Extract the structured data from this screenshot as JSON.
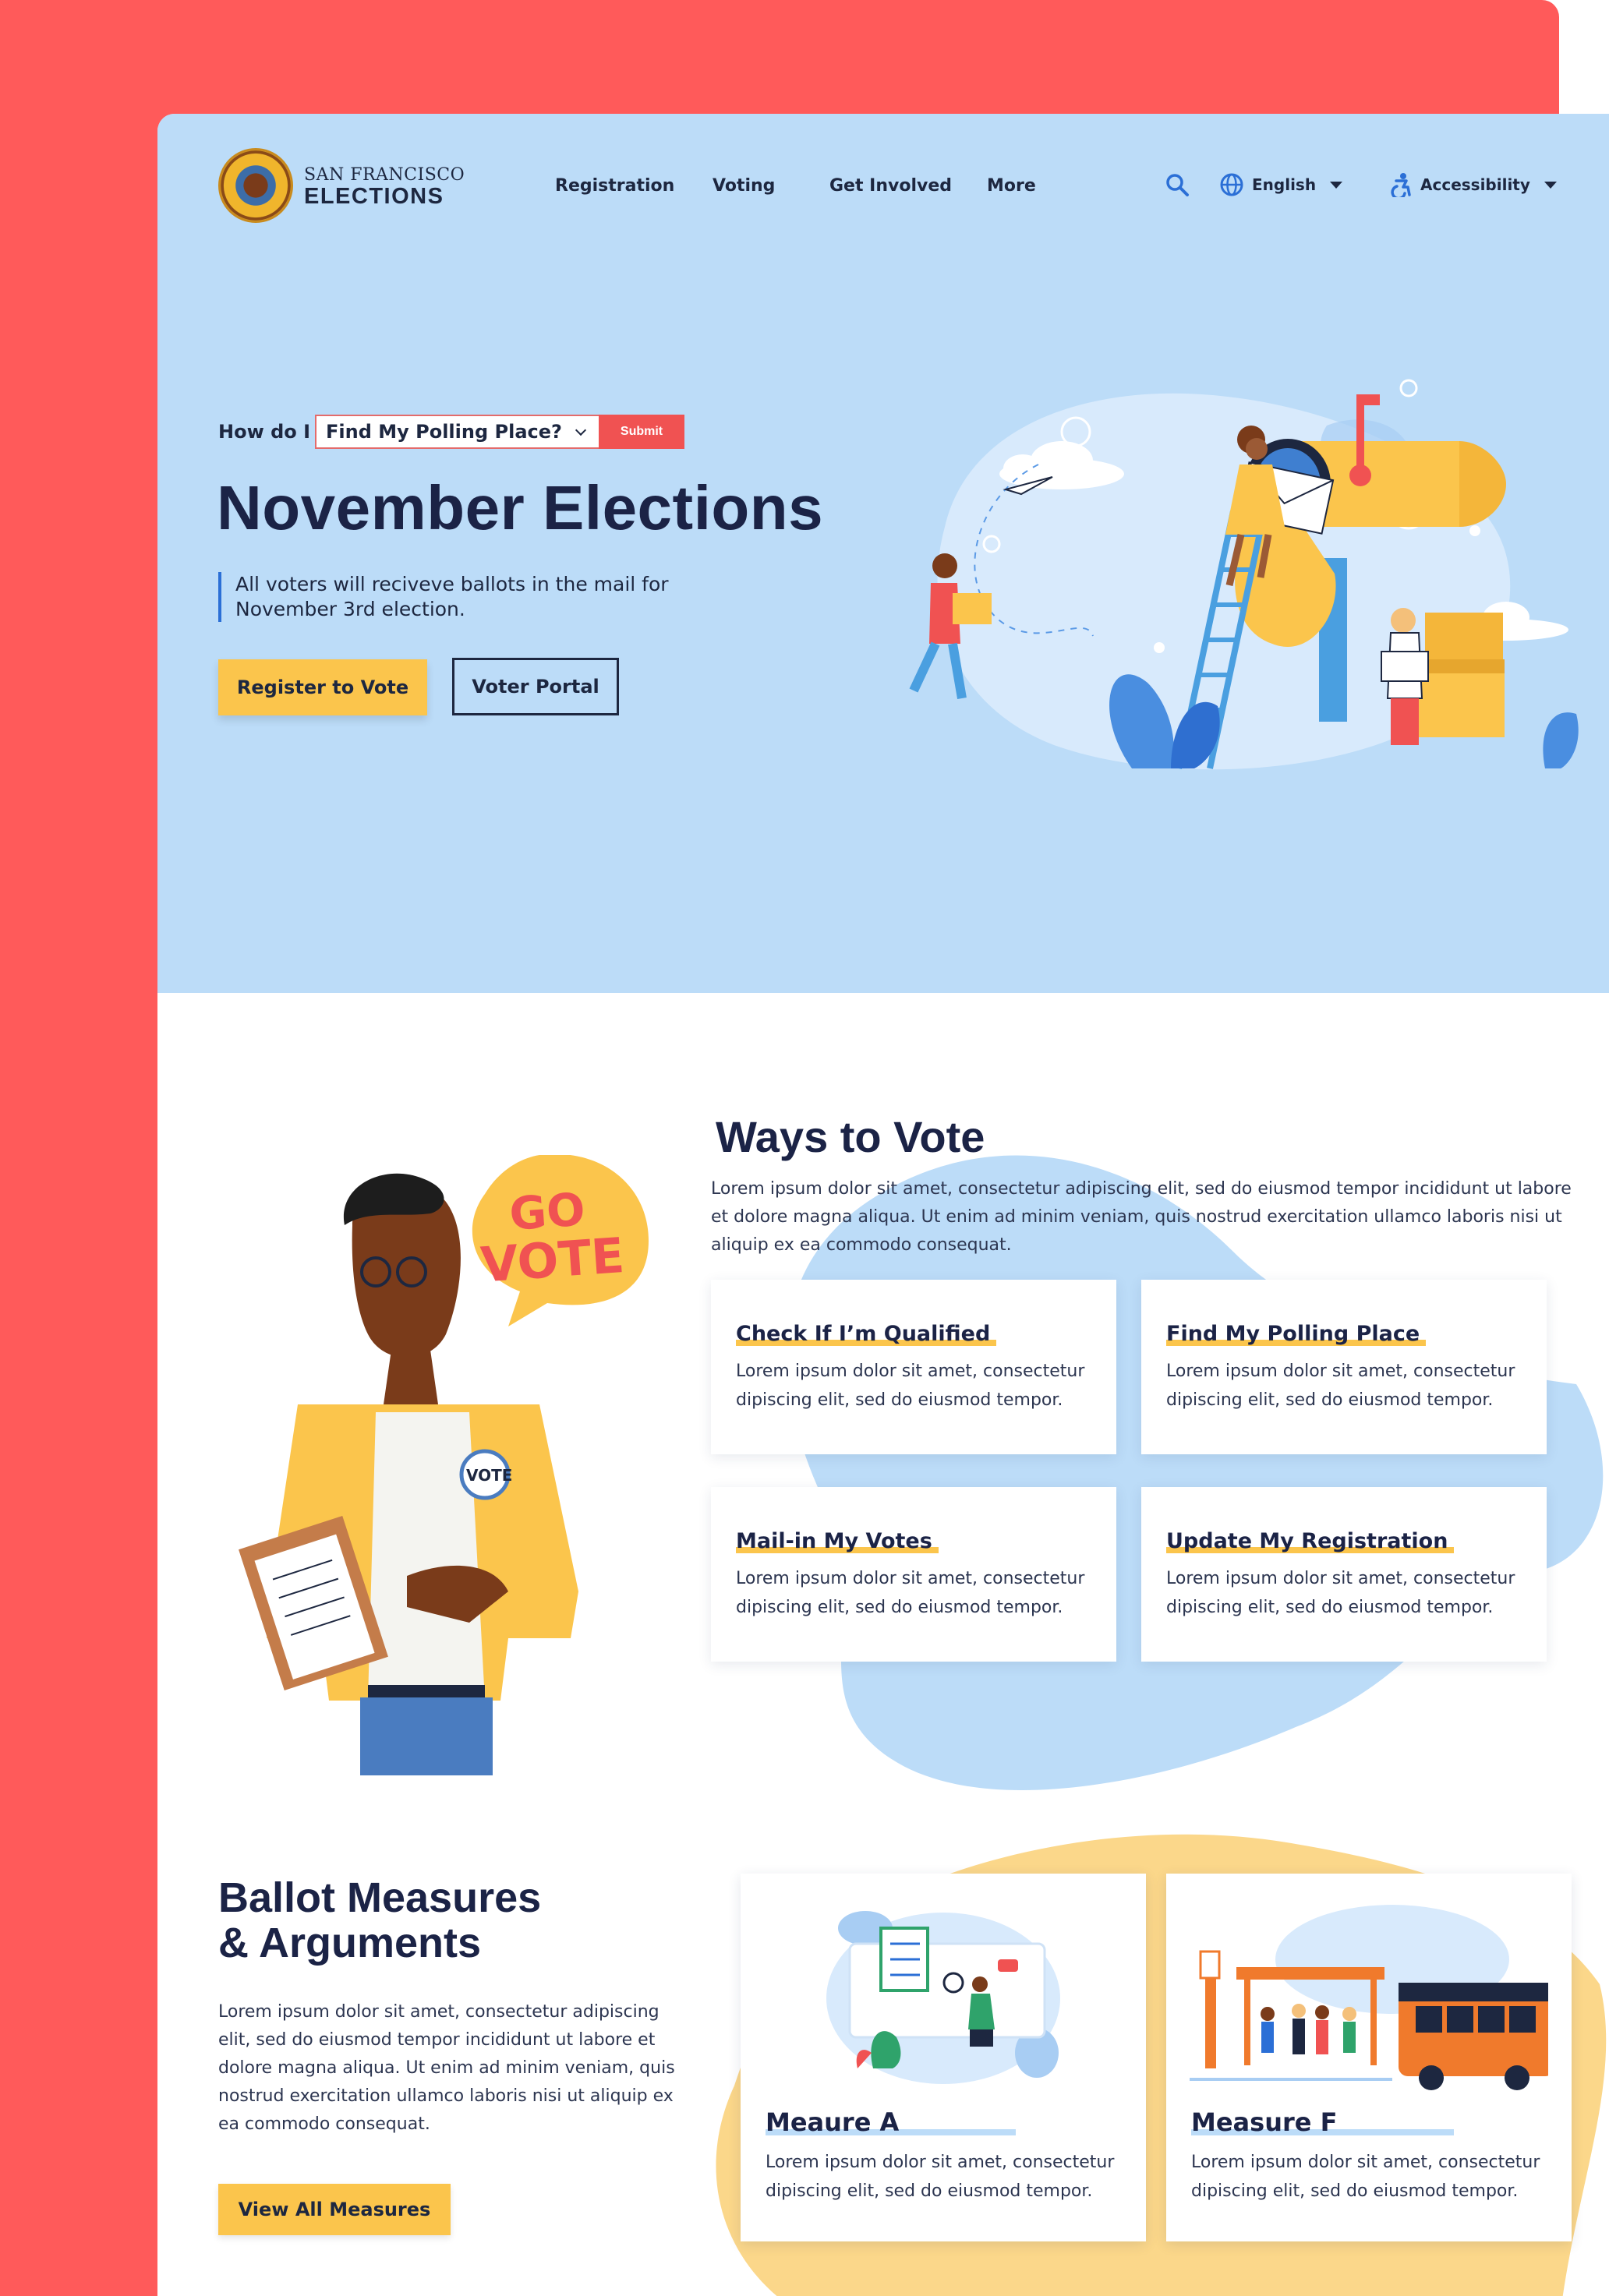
{
  "brand": {
    "line1": "SAN FRANCISCO",
    "line2": "ELECTIONS"
  },
  "nav": {
    "items": [
      {
        "label": "Registration"
      },
      {
        "label": "Voting"
      },
      {
        "label": "Get Involved"
      },
      {
        "label": "More"
      }
    ],
    "language": "English",
    "accessibility": "Accessibility"
  },
  "hero": {
    "how_do_i_label": "How do I",
    "how_do_i_selected": "Find My Polling Place?",
    "submit_label": "Submit",
    "title": "November Elections",
    "subtitle": "All voters will reciveve ballots in the mail for November 3rd election.",
    "primary_button": "Register to Vote",
    "secondary_button": "Voter Portal"
  },
  "ways": {
    "title": "Ways to Vote",
    "intro": "Lorem ipsum dolor sit amet, consectetur adipiscing elit, sed do eiusmod tempor incididunt ut labore et dolore magna aliqua. Ut enim ad minim veniam, quis nostrud exercitation ullamco laboris nisi ut aliquip ex ea commodo consequat.",
    "speech_bubble": [
      "GO",
      "VOTE"
    ],
    "badge": "VOTE",
    "cards": [
      {
        "title": "Check If I’m Qualified",
        "text": "Lorem ipsum dolor sit amet, consectetur dipiscing elit, sed do eiusmod tempor."
      },
      {
        "title": "Find My Polling Place",
        "text": "Lorem ipsum dolor sit amet, consectetur dipiscing elit, sed do eiusmod tempor."
      },
      {
        "title": "Mail-in My Votes",
        "text": "Lorem ipsum dolor sit amet, consectetur dipiscing elit, sed do eiusmod tempor."
      },
      {
        "title": "Update My Registration",
        "text": "Lorem ipsum dolor sit amet, consectetur dipiscing elit, sed do eiusmod tempor."
      }
    ]
  },
  "ballot": {
    "title_line1": "Ballot Measures",
    "title_line2": "& Arguments",
    "intro": "Lorem ipsum dolor sit amet, consectetur adipiscing elit, sed do eiusmod tempor incididunt ut labore et dolore magna aliqua. Ut enim ad minim veniam, quis nostrud exercitation ullamco laboris nisi ut aliquip ex ea commodo consequat.",
    "button": "View All Measures",
    "measures": [
      {
        "title": "Meaure A",
        "text": "Lorem ipsum dolor sit amet, consectetur dipiscing elit, sed do eiusmod tempor."
      },
      {
        "title": "Measure F",
        "text": "Lorem ipsum dolor sit amet, consectetur dipiscing elit, sed do eiusmod tempor."
      }
    ]
  },
  "colors": {
    "frame": "#ff5a5a",
    "hero_bg": "#bcdcf8",
    "accent_yellow": "#fbc54c",
    "accent_blue": "#2b6fd6",
    "submit_red": "#f05252",
    "text_dark": "#1b2346"
  },
  "icons": [
    "search-icon",
    "globe-icon",
    "accessibility-icon",
    "chevron-down-icon"
  ]
}
